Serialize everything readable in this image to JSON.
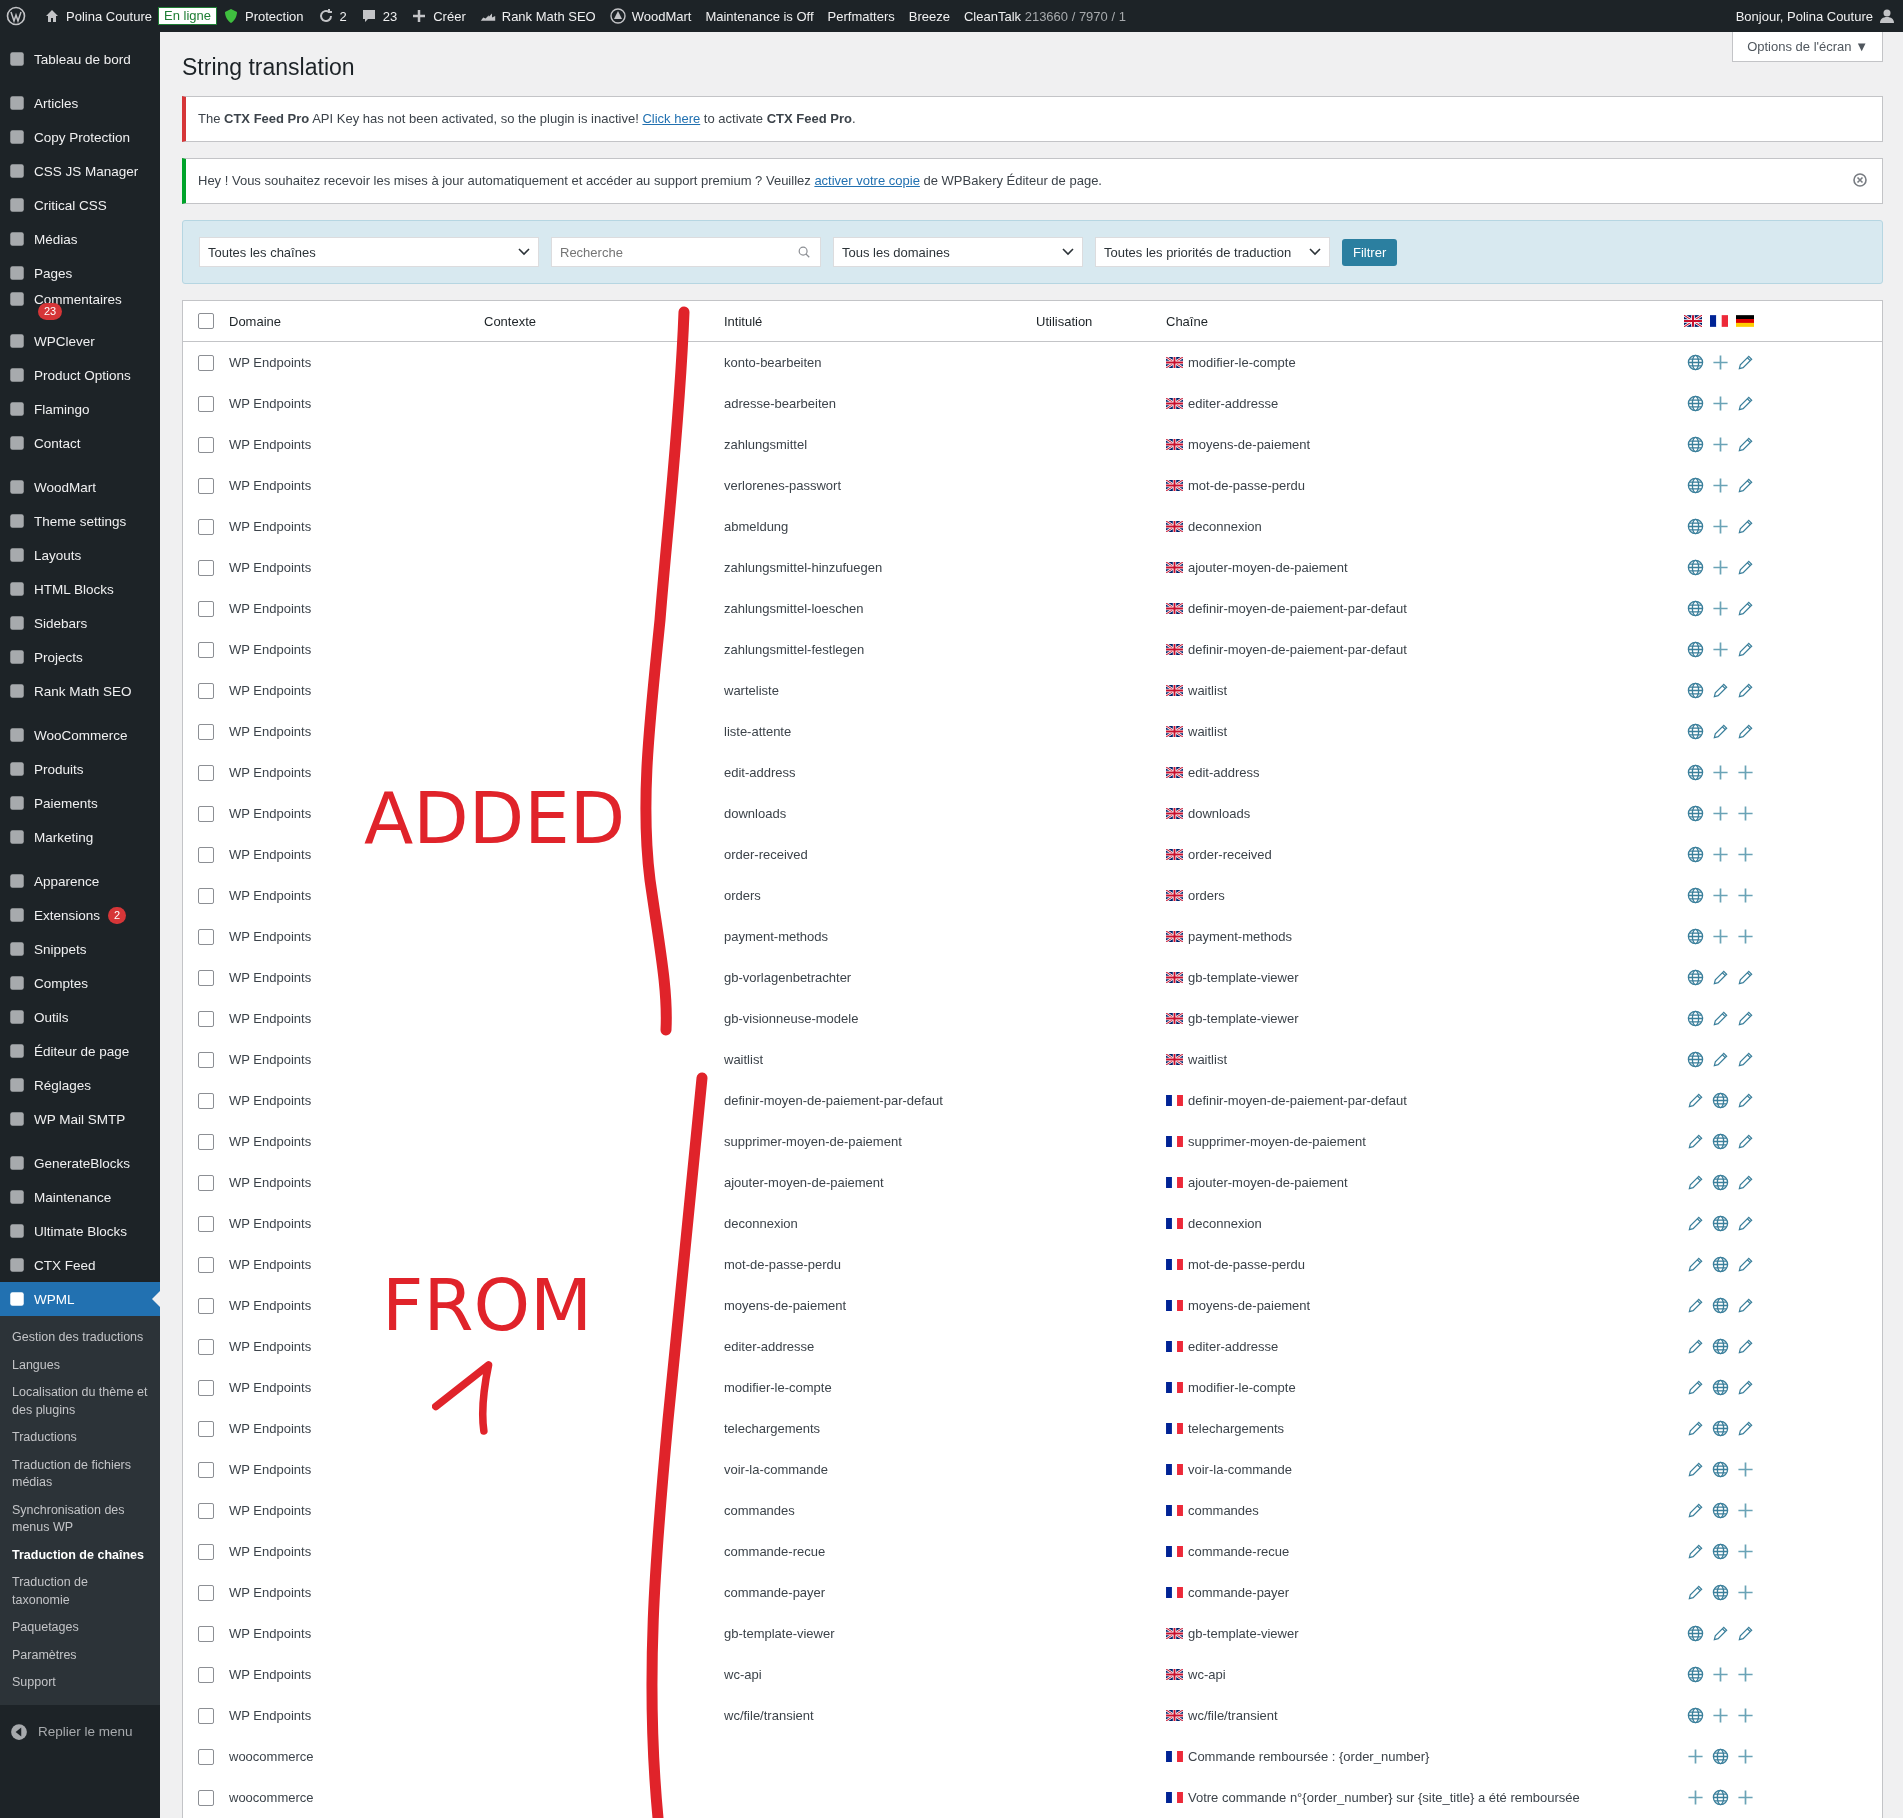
{
  "admin_bar": {
    "items": [
      {
        "kind": "logo"
      },
      {
        "kind": "home",
        "text": "Polina Couture"
      },
      {
        "kind": "badge",
        "text": "En ligne"
      },
      {
        "kind": "shield",
        "text": "Protection"
      },
      {
        "kind": "sync",
        "text": "2"
      },
      {
        "kind": "comment",
        "text": "23"
      },
      {
        "kind": "plus",
        "text": "Créer"
      },
      {
        "kind": "chart",
        "text": "Rank Math SEO"
      },
      {
        "kind": "circle",
        "text": "WoodMart"
      },
      {
        "kind": "plain",
        "text": "Maintenance is Off"
      },
      {
        "kind": "plain",
        "text": "Perfmatters"
      },
      {
        "kind": "plain",
        "text": "Breeze"
      },
      {
        "kind": "stat",
        "text": "CleanTalk",
        "stat": "213660 / 7970 / 1"
      }
    ],
    "greeting": "Bonjour, Polina Couture"
  },
  "sidebar": {
    "groups": [
      [
        {
          "label": "Tableau de bord",
          "selected": false
        }
      ],
      [
        {
          "label": "Articles",
          "selected": false
        },
        {
          "label": "Copy Protection",
          "selected": false
        },
        {
          "label": "CSS JS Manager",
          "selected": false
        },
        {
          "label": "Critical CSS",
          "selected": false
        },
        {
          "label": "Médias",
          "selected": false
        },
        {
          "label": "Pages",
          "selected": false
        },
        {
          "label": "Commentaires",
          "selected": false,
          "badge": "23"
        },
        {
          "label": "WPClever",
          "selected": false
        },
        {
          "label": "Product Options",
          "selected": false
        },
        {
          "label": "Flamingo",
          "selected": false
        },
        {
          "label": "Contact",
          "selected": false
        }
      ],
      [
        {
          "label": "WoodMart",
          "selected": false
        },
        {
          "label": "Theme settings",
          "selected": false
        },
        {
          "label": "Layouts",
          "selected": false
        },
        {
          "label": "HTML Blocks",
          "selected": false
        },
        {
          "label": "Sidebars",
          "selected": false
        },
        {
          "label": "Projects",
          "selected": false
        },
        {
          "label": "Rank Math SEO",
          "selected": false
        }
      ],
      [
        {
          "label": "WooCommerce",
          "selected": false
        },
        {
          "label": "Produits",
          "selected": false
        },
        {
          "label": "Paiements",
          "selected": false
        },
        {
          "label": "Marketing",
          "selected": false
        }
      ],
      [
        {
          "label": "Apparence",
          "selected": false
        },
        {
          "label": "Extensions",
          "selected": false,
          "badge": "2"
        },
        {
          "label": "Snippets",
          "selected": false
        },
        {
          "label": "Comptes",
          "selected": false
        },
        {
          "label": "Outils",
          "selected": false
        },
        {
          "label": "Éditeur de page",
          "selected": false
        },
        {
          "label": "Réglages",
          "selected": false
        },
        {
          "label": "WP Mail SMTP",
          "selected": false
        }
      ],
      [
        {
          "label": "GenerateBlocks",
          "selected": false
        },
        {
          "label": "Maintenance",
          "selected": false
        },
        {
          "label": "Ultimate Blocks",
          "selected": false
        },
        {
          "label": "CTX Feed",
          "selected": false
        },
        {
          "label": "WPML",
          "selected": true,
          "submenu": [
            {
              "label": "Gestion des traductions",
              "selected": false
            },
            {
              "label": "Langues",
              "selected": false
            },
            {
              "label": "Localisation du thème et des plugins",
              "selected": false
            },
            {
              "label": "Traductions",
              "selected": false
            },
            {
              "label": "Traduction de fichiers médias",
              "selected": false
            },
            {
              "label": "Synchronisation des menus WP",
              "selected": false
            },
            {
              "label": "Traduction de chaînes",
              "selected": true
            },
            {
              "label": "Traduction de taxonomie",
              "selected": false
            },
            {
              "label": "Paquetages",
              "selected": false
            },
            {
              "label": "Paramètres",
              "selected": false
            },
            {
              "label": "Support",
              "selected": false
            }
          ]
        }
      ]
    ],
    "collapse": "Replier le menu"
  },
  "page": {
    "title": "String translation",
    "screen_options": "Options de l'écran ▼"
  },
  "notices": [
    {
      "kind": "error",
      "text": "The **CTX Feed Pro** API Key has not been activated, so the plugin is inactive! ",
      "link": "Click here",
      "after": " to activate **CTX Feed Pro**."
    },
    {
      "kind": "success",
      "text": "Hey ! Vous souhaitez recevoir les mises à jour automatiquement et accéder au support premium ? Veuillez ",
      "link": "activer votre copie",
      "after": " de WPBakery Éditeur de page.",
      "dismissible": true
    }
  ],
  "filters": {
    "strings": "Toutes les chaînes",
    "search": {
      "placeholder": "Recherche"
    },
    "domains": "Tous les domaines",
    "priorities": "Toutes les priorités de traduction",
    "button": "Filtrer"
  },
  "table": {
    "columns": [
      "Domaine",
      "Contexte",
      "Intitulé",
      "Utilisation",
      "Chaîne"
    ],
    "header_flags": [
      {
        "kind": "uk"
      },
      {
        "kind": "fr"
      },
      {
        "kind": "de"
      }
    ],
    "select_all": false,
    "rows": [
      {
        "checked": false,
        "domain": "WP Endpoints",
        "name": "konto-bearbeiten",
        "flag": {
          "kind": "uk"
        },
        "value": "modifier-le-compte",
        "actions": [
          {
            "kind": "globe"
          },
          {
            "kind": "plus"
          },
          {
            "kind": "pencil"
          }
        ]
      },
      {
        "checked": false,
        "domain": "WP Endpoints",
        "name": "adresse-bearbeiten",
        "flag": {
          "kind": "uk"
        },
        "value": "editer-addresse",
        "actions": [
          {
            "kind": "globe"
          },
          {
            "kind": "plus"
          },
          {
            "kind": "pencil"
          }
        ]
      },
      {
        "checked": false,
        "domain": "WP Endpoints",
        "name": "zahlungsmittel",
        "flag": {
          "kind": "uk"
        },
        "value": "moyens-de-paiement",
        "actions": [
          {
            "kind": "globe"
          },
          {
            "kind": "plus"
          },
          {
            "kind": "pencil"
          }
        ]
      },
      {
        "checked": false,
        "domain": "WP Endpoints",
        "name": "verlorenes-passwort",
        "flag": {
          "kind": "uk"
        },
        "value": "mot-de-passe-perdu",
        "actions": [
          {
            "kind": "globe"
          },
          {
            "kind": "plus"
          },
          {
            "kind": "pencil"
          }
        ]
      },
      {
        "checked": false,
        "domain": "WP Endpoints",
        "name": "abmeldung",
        "flag": {
          "kind": "uk"
        },
        "value": "deconnexion",
        "actions": [
          {
            "kind": "globe"
          },
          {
            "kind": "plus"
          },
          {
            "kind": "pencil"
          }
        ]
      },
      {
        "checked": false,
        "domain": "WP Endpoints",
        "name": "zahlungsmittel-hinzufuegen",
        "flag": {
          "kind": "uk"
        },
        "value": "ajouter-moyen-de-paiement",
        "actions": [
          {
            "kind": "globe"
          },
          {
            "kind": "plus"
          },
          {
            "kind": "pencil"
          }
        ]
      },
      {
        "checked": false,
        "domain": "WP Endpoints",
        "name": "zahlungsmittel-loeschen",
        "flag": {
          "kind": "uk"
        },
        "value": "definir-moyen-de-paiement-par-defaut",
        "actions": [
          {
            "kind": "globe"
          },
          {
            "kind": "plus"
          },
          {
            "kind": "pencil"
          }
        ]
      },
      {
        "checked": false,
        "domain": "WP Endpoints",
        "name": "zahlungsmittel-festlegen",
        "flag": {
          "kind": "uk"
        },
        "value": "definir-moyen-de-paiement-par-defaut",
        "actions": [
          {
            "kind": "globe"
          },
          {
            "kind": "plus"
          },
          {
            "kind": "pencil"
          }
        ]
      },
      {
        "checked": false,
        "domain": "WP Endpoints",
        "name": "warteliste",
        "flag": {
          "kind": "uk"
        },
        "value": "waitlist",
        "actions": [
          {
            "kind": "globe"
          },
          {
            "kind": "pencil"
          },
          {
            "kind": "pencil"
          }
        ]
      },
      {
        "checked": false,
        "domain": "WP Endpoints",
        "name": "liste-attente",
        "flag": {
          "kind": "uk"
        },
        "value": "waitlist",
        "actions": [
          {
            "kind": "globe"
          },
          {
            "kind": "pencil"
          },
          {
            "kind": "pencil"
          }
        ]
      },
      {
        "checked": false,
        "domain": "WP Endpoints",
        "name": "edit-address",
        "flag": {
          "kind": "uk"
        },
        "value": "edit-address",
        "actions": [
          {
            "kind": "globe"
          },
          {
            "kind": "plus"
          },
          {
            "kind": "plus"
          }
        ]
      },
      {
        "checked": false,
        "domain": "WP Endpoints",
        "name": "downloads",
        "flag": {
          "kind": "uk"
        },
        "value": "downloads",
        "actions": [
          {
            "kind": "globe"
          },
          {
            "kind": "plus"
          },
          {
            "kind": "plus"
          }
        ]
      },
      {
        "checked": false,
        "domain": "WP Endpoints",
        "name": "order-received",
        "flag": {
          "kind": "uk"
        },
        "value": "order-received",
        "actions": [
          {
            "kind": "globe"
          },
          {
            "kind": "plus"
          },
          {
            "kind": "plus"
          }
        ]
      },
      {
        "checked": false,
        "domain": "WP Endpoints",
        "name": "orders",
        "flag": {
          "kind": "uk"
        },
        "value": "orders",
        "actions": [
          {
            "kind": "globe"
          },
          {
            "kind": "plus"
          },
          {
            "kind": "plus"
          }
        ]
      },
      {
        "checked": false,
        "domain": "WP Endpoints",
        "name": "payment-methods",
        "flag": {
          "kind": "uk"
        },
        "value": "payment-methods",
        "actions": [
          {
            "kind": "globe"
          },
          {
            "kind": "plus"
          },
          {
            "kind": "plus"
          }
        ]
      },
      {
        "checked": false,
        "domain": "WP Endpoints",
        "name": "gb-vorlagenbetrachter",
        "flag": {
          "kind": "uk"
        },
        "value": "gb-template-viewer",
        "actions": [
          {
            "kind": "globe"
          },
          {
            "kind": "pencil"
          },
          {
            "kind": "pencil"
          }
        ]
      },
      {
        "checked": false,
        "domain": "WP Endpoints",
        "name": "gb-visionneuse-modele",
        "flag": {
          "kind": "uk"
        },
        "value": "gb-template-viewer",
        "actions": [
          {
            "kind": "globe"
          },
          {
            "kind": "pencil"
          },
          {
            "kind": "pencil"
          }
        ]
      },
      {
        "checked": false,
        "domain": "WP Endpoints",
        "name": "waitlist",
        "flag": {
          "kind": "uk"
        },
        "value": "waitlist",
        "actions": [
          {
            "kind": "globe"
          },
          {
            "kind": "pencil"
          },
          {
            "kind": "pencil"
          }
        ]
      },
      {
        "checked": false,
        "domain": "WP Endpoints",
        "name": "definir-moyen-de-paiement-par-defaut",
        "flag": {
          "kind": "fr"
        },
        "value": "definir-moyen-de-paiement-par-defaut",
        "actions": [
          {
            "kind": "pencil"
          },
          {
            "kind": "globe"
          },
          {
            "kind": "pencil"
          }
        ]
      },
      {
        "checked": false,
        "domain": "WP Endpoints",
        "name": "supprimer-moyen-de-paiement",
        "flag": {
          "kind": "fr"
        },
        "value": "supprimer-moyen-de-paiement",
        "actions": [
          {
            "kind": "pencil"
          },
          {
            "kind": "globe"
          },
          {
            "kind": "pencil"
          }
        ]
      },
      {
        "checked": false,
        "domain": "WP Endpoints",
        "name": "ajouter-moyen-de-paiement",
        "flag": {
          "kind": "fr"
        },
        "value": "ajouter-moyen-de-paiement",
        "actions": [
          {
            "kind": "pencil"
          },
          {
            "kind": "globe"
          },
          {
            "kind": "pencil"
          }
        ]
      },
      {
        "checked": false,
        "domain": "WP Endpoints",
        "name": "deconnexion",
        "flag": {
          "kind": "fr"
        },
        "value": "deconnexion",
        "actions": [
          {
            "kind": "pencil"
          },
          {
            "kind": "globe"
          },
          {
            "kind": "pencil"
          }
        ]
      },
      {
        "checked": false,
        "domain": "WP Endpoints",
        "name": "mot-de-passe-perdu",
        "flag": {
          "kind": "fr"
        },
        "value": "mot-de-passe-perdu",
        "actions": [
          {
            "kind": "pencil"
          },
          {
            "kind": "globe"
          },
          {
            "kind": "pencil"
          }
        ]
      },
      {
        "checked": false,
        "domain": "WP Endpoints",
        "name": "moyens-de-paiement",
        "flag": {
          "kind": "fr"
        },
        "value": "moyens-de-paiement",
        "actions": [
          {
            "kind": "pencil"
          },
          {
            "kind": "globe"
          },
          {
            "kind": "pencil"
          }
        ]
      },
      {
        "checked": false,
        "domain": "WP Endpoints",
        "name": "editer-addresse",
        "flag": {
          "kind": "fr"
        },
        "value": "editer-addresse",
        "actions": [
          {
            "kind": "pencil"
          },
          {
            "kind": "globe"
          },
          {
            "kind": "pencil"
          }
        ]
      },
      {
        "checked": false,
        "domain": "WP Endpoints",
        "name": "modifier-le-compte",
        "flag": {
          "kind": "fr"
        },
        "value": "modifier-le-compte",
        "actions": [
          {
            "kind": "pencil"
          },
          {
            "kind": "globe"
          },
          {
            "kind": "pencil"
          }
        ]
      },
      {
        "checked": false,
        "domain": "WP Endpoints",
        "name": "telechargements",
        "flag": {
          "kind": "fr"
        },
        "value": "telechargements",
        "actions": [
          {
            "kind": "pencil"
          },
          {
            "kind": "globe"
          },
          {
            "kind": "pencil"
          }
        ]
      },
      {
        "checked": false,
        "domain": "WP Endpoints",
        "name": "voir-la-commande",
        "flag": {
          "kind": "fr"
        },
        "value": "voir-la-commande",
        "actions": [
          {
            "kind": "pencil"
          },
          {
            "kind": "globe"
          },
          {
            "kind": "plus"
          }
        ]
      },
      {
        "checked": false,
        "domain": "WP Endpoints",
        "name": "commandes",
        "flag": {
          "kind": "fr"
        },
        "value": "commandes",
        "actions": [
          {
            "kind": "pencil"
          },
          {
            "kind": "globe"
          },
          {
            "kind": "plus"
          }
        ]
      },
      {
        "checked": false,
        "domain": "WP Endpoints",
        "name": "commande-recue",
        "flag": {
          "kind": "fr"
        },
        "value": "commande-recue",
        "actions": [
          {
            "kind": "pencil"
          },
          {
            "kind": "globe"
          },
          {
            "kind": "plus"
          }
        ]
      },
      {
        "checked": false,
        "domain": "WP Endpoints",
        "name": "commande-payer",
        "flag": {
          "kind": "fr"
        },
        "value": "commande-payer",
        "actions": [
          {
            "kind": "pencil"
          },
          {
            "kind": "globe"
          },
          {
            "kind": "plus"
          }
        ]
      },
      {
        "checked": false,
        "domain": "WP Endpoints",
        "name": "gb-template-viewer",
        "flag": {
          "kind": "uk"
        },
        "value": "gb-template-viewer",
        "actions": [
          {
            "kind": "globe"
          },
          {
            "kind": "pencil"
          },
          {
            "kind": "pencil"
          }
        ]
      },
      {
        "checked": false,
        "domain": "WP Endpoints",
        "name": "wc-api",
        "flag": {
          "kind": "uk"
        },
        "value": "wc-api",
        "actions": [
          {
            "kind": "globe"
          },
          {
            "kind": "plus"
          },
          {
            "kind": "plus"
          }
        ]
      },
      {
        "checked": false,
        "domain": "WP Endpoints",
        "name": "wc/file/transient",
        "flag": {
          "kind": "uk"
        },
        "value": "wc/file/transient",
        "actions": [
          {
            "kind": "globe"
          },
          {
            "kind": "plus"
          },
          {
            "kind": "plus"
          }
        ]
      },
      {
        "checked": false,
        "domain": "woocommerce",
        "flag": {
          "kind": "fr"
        },
        "value": "Commande remboursée : {order_number}",
        "actions": [
          {
            "kind": "plus"
          },
          {
            "kind": "globe"
          },
          {
            "kind": "plus"
          }
        ]
      },
      {
        "checked": false,
        "domain": "woocommerce",
        "flag": {
          "kind": "fr"
        },
        "value": "Votre commande n°{order_number} sur {site_title} a été remboursée",
        "actions": [
          {
            "kind": "plus"
          },
          {
            "kind": "globe"
          },
          {
            "kind": "plus"
          }
        ]
      }
    ]
  },
  "annotations": [
    {
      "kind": "added",
      "text": "ADDED"
    },
    {
      "kind": "from",
      "text": "FROM"
    }
  ]
}
